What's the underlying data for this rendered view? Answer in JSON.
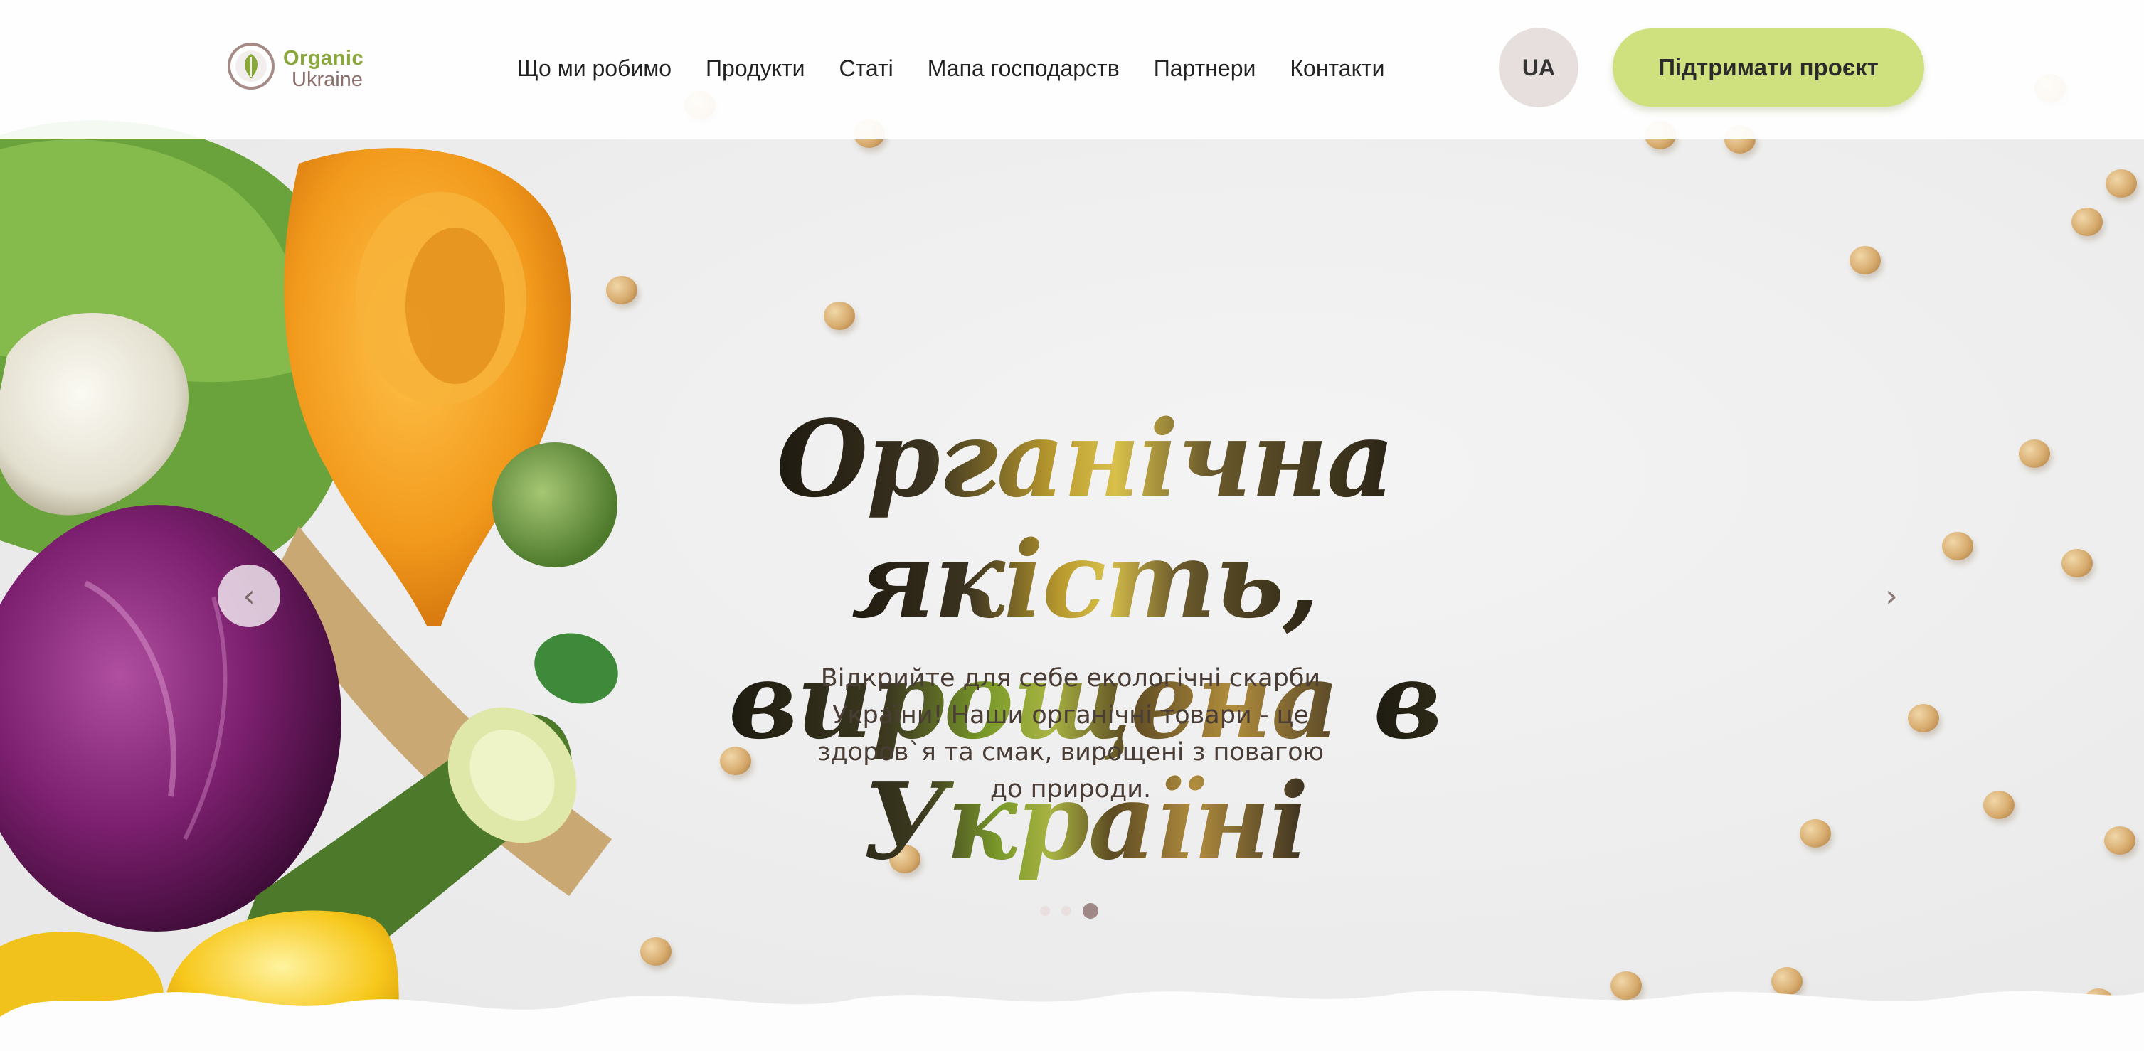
{
  "brand": {
    "name_line1": "Organic",
    "name_line2": "Ukraine",
    "color_green": "#8aa83a",
    "color_mauve": "#8c6f6a"
  },
  "nav": {
    "items": [
      "Що ми робимо",
      "Продукти",
      "Статі",
      "Мапа господарств",
      "Партнери",
      "Контакти"
    ]
  },
  "language": {
    "label": "UA"
  },
  "cta": {
    "label": "Підтримати проєкт",
    "color": "#cfe07f"
  },
  "hero": {
    "title_line1_a": "Органічна ",
    "title_line1_b": "якість,",
    "title_line2_a": "вирощена ",
    "title_line2_b": "в Україні",
    "subtitle": "Відкрийте для себе екологічні скарби України! Наши органічні товари - це здоров`я та смак, вирощені з повагою до природи.",
    "prev_arrow": "‹",
    "next_arrow": "›",
    "slides_total": 3,
    "active_slide": 3
  },
  "icons": {
    "logo": "leaf-circle-logo-icon",
    "prev": "chevron-left-icon",
    "next": "chevron-right-icon"
  }
}
